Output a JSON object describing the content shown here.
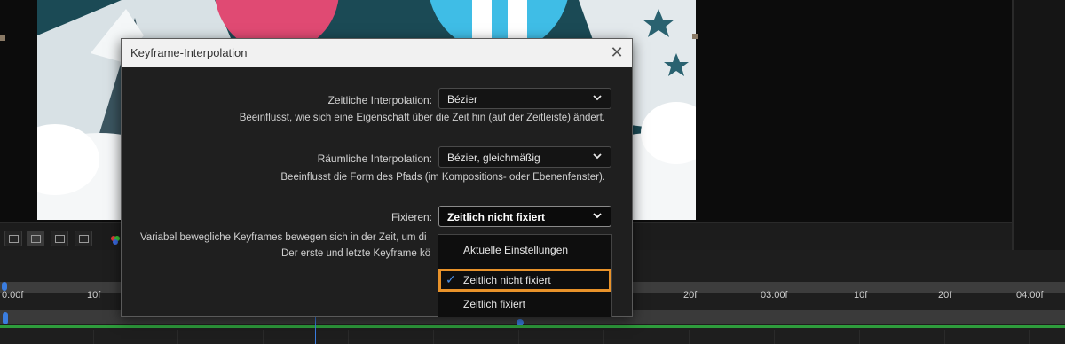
{
  "dialog": {
    "title": "Keyframe-Interpolation",
    "temporal": {
      "label": "Zeitliche Interpolation:",
      "value": "Bézier",
      "description": "Beeinflusst, wie sich eine Eigenschaft über die Zeit hin (auf der Zeitleiste) ändert."
    },
    "spatial": {
      "label": "Räumliche Interpolation:",
      "value": "Bézier, gleichmäßig",
      "description": "Beeinflusst die Form des Pfads (im Kompositions- oder Ebenenfenster)."
    },
    "roving": {
      "label": "Fixieren:",
      "value": "Zeitlich nicht fixiert",
      "description_line1": "Variabel bewegliche Keyframes bewegen sich in der Zeit, um di",
      "description_line2": "Der erste und letzte Keyframe kö"
    }
  },
  "dropdown": {
    "items": [
      {
        "label": "Aktuelle Einstellungen",
        "selected": false
      },
      {
        "label": "Zeitlich nicht fixiert",
        "selected": true
      },
      {
        "label": "Zeitlich fixiert",
        "selected": false
      }
    ]
  },
  "timeline": {
    "ticks": [
      "0:00f",
      "10f",
      "20f",
      "03:00f",
      "10f",
      "20f",
      "04:00f"
    ]
  },
  "colors": {
    "accent_blue": "#3a7de0",
    "highlight_orange": "#e8922a",
    "work_area_green": "#2e9c3c"
  }
}
